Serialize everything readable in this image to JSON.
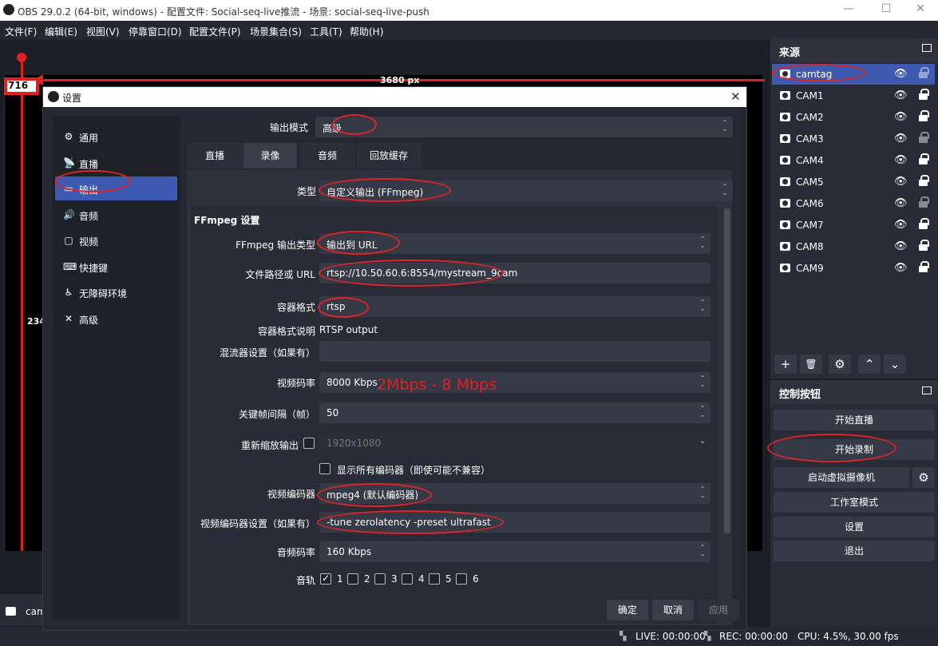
{
  "titlebar": {
    "title": "OBS 29.0.2 (64-bit, windows) - 配置文件: Social-seq-live推流 - 场景: social-seq-live-push",
    "minimize": "—",
    "maximize": "☐",
    "close": "✕"
  },
  "menu": [
    "文件(F)",
    "编辑(E)",
    "视图(V)",
    "停靠窗口(D)",
    "配置文件(P)",
    "场景集合(S)",
    "工具(T)",
    "帮助(H)"
  ],
  "preview": {
    "width_label": "3680 px",
    "x_label": "716",
    "height_label": "234"
  },
  "sources": {
    "title": "来源",
    "items": [
      {
        "name": "camtag",
        "locked": false,
        "selected": true
      },
      {
        "name": "CAM1",
        "locked": true
      },
      {
        "name": "CAM2",
        "locked": true
      },
      {
        "name": "CAM3",
        "locked": false
      },
      {
        "name": "CAM4",
        "locked": true
      },
      {
        "name": "CAM5",
        "locked": true
      },
      {
        "name": "CAM6",
        "locked": false
      },
      {
        "name": "CAM7",
        "locked": true
      },
      {
        "name": "CAM8",
        "locked": true
      },
      {
        "name": "CAM9",
        "locked": true
      }
    ],
    "tools": {
      "add": "+",
      "remove": "🗑",
      "settings": "⚙",
      "up": "⌃",
      "down": "⌄"
    }
  },
  "controls": {
    "title": "控制按钮",
    "start_stream": "开始直播",
    "start_record": "开始录制",
    "virtual_cam": "启动虚拟摄像机",
    "studio_mode": "工作室模式",
    "settings": "设置",
    "exit": "退出"
  },
  "bottom_source": "cam",
  "status": {
    "live": "LIVE: 00:00:00",
    "rec": "REC: 00:00:00",
    "cpu": "CPU: 4.5%, 30.00 fps"
  },
  "settings": {
    "title": "设置",
    "nav": [
      {
        "icon": "gear-icon",
        "glyph": "⚙",
        "label": "通用"
      },
      {
        "icon": "broadcast-icon",
        "glyph": "📡",
        "label": "直播"
      },
      {
        "icon": "output-icon",
        "glyph": "▭",
        "label": "输出"
      },
      {
        "icon": "audio-icon",
        "glyph": "🔊",
        "label": "音频"
      },
      {
        "icon": "video-icon",
        "glyph": "▢",
        "label": "视频"
      },
      {
        "icon": "keyboard-icon",
        "glyph": "⌨",
        "label": "快捷键"
      },
      {
        "icon": "accessibility-icon",
        "glyph": "♿",
        "label": "无障碍环境"
      },
      {
        "icon": "advanced-icon",
        "glyph": "✕",
        "label": "高级"
      }
    ],
    "output_mode_label": "输出模式",
    "output_mode": "高级",
    "tabs": [
      "直播",
      "录像",
      "音频",
      "回放缓存"
    ],
    "type_label": "类型",
    "type": "自定义输出 (FFmpeg)",
    "ffmpeg_header": "FFmpeg 设置",
    "ffmpeg_output_type_label": "FFmpeg 输出类型",
    "ffmpeg_output_type": "输出到 URL",
    "path_label": "文件路径或 URL",
    "path": "rtsp://10.50.60.6:8554/mystream_9cam",
    "container_label": "容器格式",
    "container": "rtsp",
    "container_desc_label": "容器格式说明",
    "container_desc": "RTSP output",
    "muxer_label": "混流器设置（如果有）",
    "muxer": "",
    "vbitrate_label": "视频码率",
    "vbitrate": "8000 Kbps",
    "vbitrate_note": "2Mbps - 8 Mbps",
    "keyint_label": "关键帧间隔（帧）",
    "keyint": "50",
    "rescale_label": "重新缩放输出",
    "rescale": "1920x1080",
    "show_all_label": "显示所有编码器（即使可能不兼容）",
    "vencoder_label": "视频编码器",
    "vencoder": "mpeg4 (默认编码器)",
    "vencoder_settings_label": "视频编码器设置（如果有）",
    "vencoder_settings": "-tune zerolatency -preset ultrafast",
    "abitrate_label": "音频码率",
    "abitrate": "160 Kbps",
    "tracks_label": "音轨",
    "tracks": [
      "1",
      "2",
      "3",
      "4",
      "5",
      "6"
    ],
    "ok": "确定",
    "cancel": "取消",
    "apply": "应用"
  }
}
